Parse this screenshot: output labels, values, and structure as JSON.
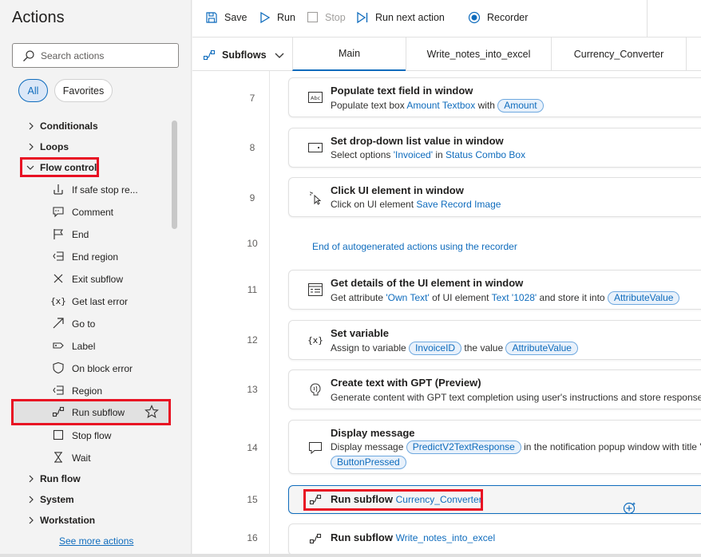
{
  "actions_pane": {
    "title": "Actions",
    "search_placeholder": "Search actions",
    "filters": [
      "All",
      "Favorites"
    ],
    "categories_top": [
      "Conditionals",
      "Loops"
    ],
    "flow_control_label": "Flow control",
    "flow_control_items": [
      {
        "label": "If safe stop re...",
        "icon": "if-safe-stop-icon"
      },
      {
        "label": "Comment",
        "icon": "comment-icon"
      },
      {
        "label": "End",
        "icon": "end-flag-icon"
      },
      {
        "label": "End region",
        "icon": "end-region-icon"
      },
      {
        "label": "Exit subflow",
        "icon": "close-icon"
      },
      {
        "label": "Get last error",
        "icon": "variable-icon"
      },
      {
        "label": "Go to",
        "icon": "arrow-up-right-icon"
      },
      {
        "label": "Label",
        "icon": "label-tag-icon"
      },
      {
        "label": "On block error",
        "icon": "shield-icon"
      },
      {
        "label": "Region",
        "icon": "region-icon"
      },
      {
        "label": "Run subflow",
        "icon": "run-subflow-icon"
      },
      {
        "label": "Stop flow",
        "icon": "stop-square-icon"
      },
      {
        "label": "Wait",
        "icon": "hourglass-icon"
      }
    ],
    "categories_bottom": [
      "Run flow",
      "System",
      "Workstation"
    ],
    "see_more": "See more actions"
  },
  "toolbar": {
    "save": "Save",
    "run": "Run",
    "stop": "Stop",
    "run_next": "Run next action",
    "recorder": "Recorder"
  },
  "tabs": {
    "subflows": "Subflows",
    "items": [
      "Main",
      "Write_notes_into_excel",
      "Currency_Converter"
    ]
  },
  "steps": [
    {
      "no": "7",
      "title": "Populate text field in window",
      "desc_a": "Populate text box ",
      "link1": "Amount Textbox",
      "desc_b": " with ",
      "token1": "Amount"
    },
    {
      "no": "8",
      "title": "Set drop-down list value in window",
      "desc_a": "Select options ",
      "link1": "'Invoiced'",
      "desc_b": " in ",
      "link2": "Status Combo Box"
    },
    {
      "no": "9",
      "title": "Click UI element in window",
      "desc_a": "Click on UI element ",
      "link1": "Save Record Image"
    },
    {
      "no": "10",
      "text": "End of autogenerated actions using the recorder"
    },
    {
      "no": "11",
      "title": "Get details of the UI element in window",
      "desc_a": "Get attribute ",
      "link1": "'Own Text'",
      "desc_b": " of UI element ",
      "link2": "Text '1028'",
      "desc_c": " and store it into ",
      "token1": "AttributeValue"
    },
    {
      "no": "12",
      "title": "Set variable",
      "desc_a": "Assign to variable ",
      "token1": "InvoiceID",
      "desc_b": " the value ",
      "token2": "AttributeValue"
    },
    {
      "no": "13",
      "title": "Create text with GPT (Preview)",
      "desc_a": "Generate content with GPT text completion using user's instructions and store response"
    },
    {
      "no": "14",
      "title": "Display message",
      "desc_a": "Display message ",
      "token1": "PredictV2TextResponse",
      "desc_b": " in the notification popup window with title '",
      "token2": "ButtonPressed"
    },
    {
      "no": "15",
      "title": "Run subflow",
      "link1": "Currency_Converter"
    },
    {
      "no": "16",
      "title": "Run subflow",
      "link1": "Write_notes_into_excel"
    }
  ],
  "colors": {
    "accent": "#0f6cbd",
    "highlight": "#e81123"
  }
}
